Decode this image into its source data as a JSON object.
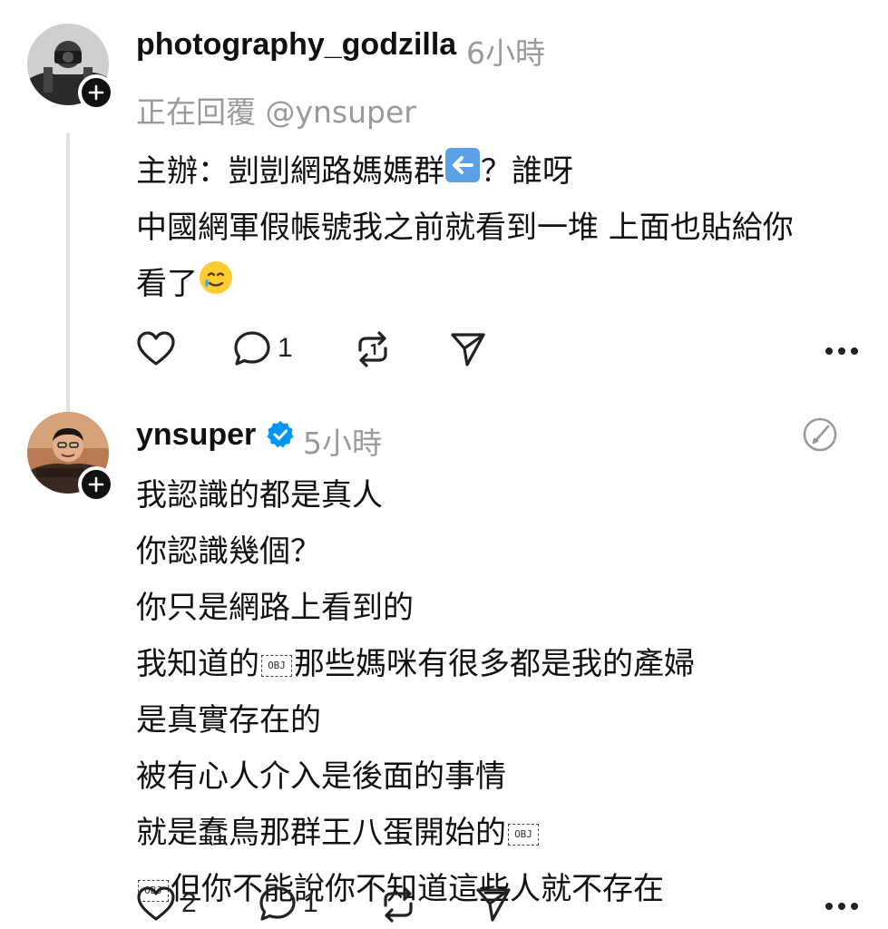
{
  "post1": {
    "username": "photography_godzilla",
    "time": "6小時",
    "replying_to": "正在回覆 @ynsuper",
    "lines": [
      "主辦：剴剴網路媽媽群",
      "？誰呀",
      "中國網軍假帳號我之前就看到一堆 上面也貼給你",
      "看了"
    ],
    "emoji_arrow": "left-arrow-emoji",
    "emoji_face": "smiling-face-with-tear-emoji",
    "actions": {
      "like_count": "",
      "comment_count": "1"
    }
  },
  "post2": {
    "username": "ynsuper",
    "time": "5小時",
    "verified": true,
    "lines": [
      "我認識的都是真人",
      "你認識幾個？",
      "你只是網路上看到的",
      "我知道的",
      "那些媽咪有很多都是我的產婦",
      "是真實存在的",
      "被有心人介入是後面的事情",
      "就是蠢鳥那群王八蛋開始的",
      "但你不能說你不知道這些人就不存在"
    ],
    "obj_label": "OBJ",
    "actions": {
      "like_count": "2",
      "comment_count": "1"
    }
  },
  "colors": {
    "text": "#111111",
    "muted": "#9a9a9a",
    "verified": "#0095f6",
    "thread_line": "#e2e2e2"
  }
}
